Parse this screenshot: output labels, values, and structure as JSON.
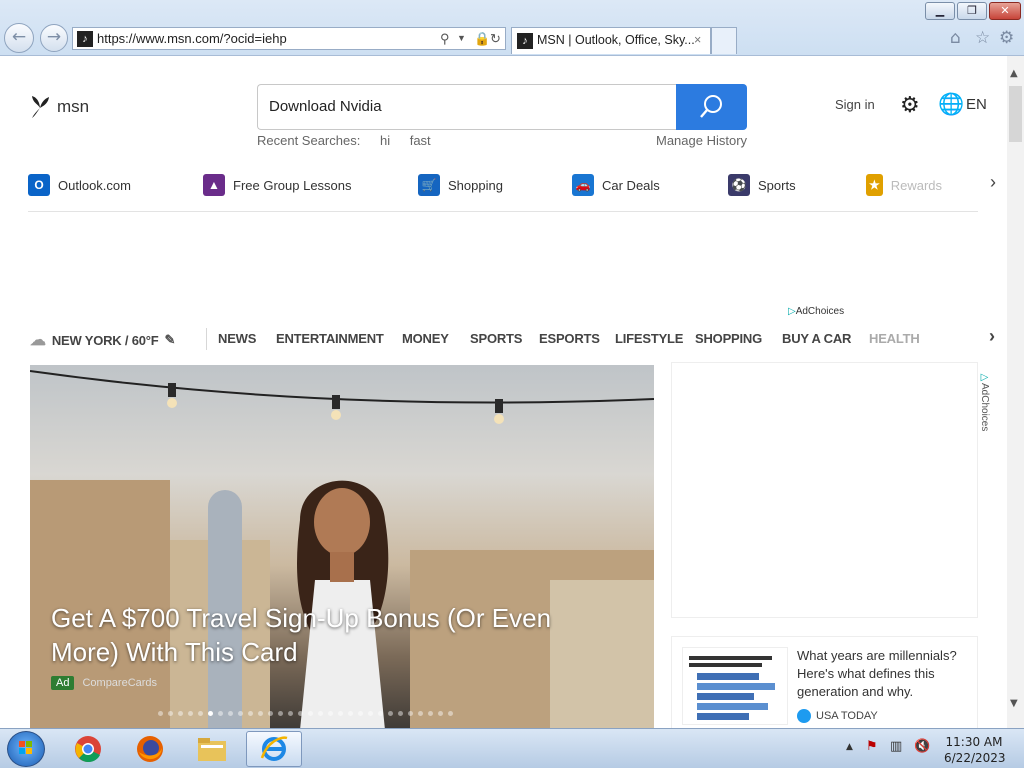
{
  "browser": {
    "address": "https://www.msn.com/?ocid=iehp",
    "tab_title": "MSN | Outlook, Office, Sky...",
    "tab_close": "×",
    "window": {
      "minimize": "▁",
      "maximize": "❐",
      "close": "✕"
    }
  },
  "msn": {
    "logo_text": "msn",
    "search_value": "Download Nvidia",
    "recent_label": "Recent Searches:",
    "recent_items": [
      "hi",
      "fast"
    ],
    "manage_history": "Manage History",
    "sign_in": "Sign in",
    "lang": "EN"
  },
  "quick_links": [
    {
      "label": "Outlook.com",
      "icon": "outlook-icon",
      "color": "#0a64c8"
    },
    {
      "label": "Free Group Lessons",
      "icon": "graduation-cap-icon",
      "color": "#6a2c8a"
    },
    {
      "label": "Shopping",
      "icon": "shopping-cart-icon",
      "color": "#1565c0"
    },
    {
      "label": "Car Deals",
      "icon": "car-icon",
      "color": "#1976d2"
    },
    {
      "label": "Sports",
      "icon": "sports-ball-icon",
      "color": "#3a3a6a"
    },
    {
      "label": "Rewards",
      "icon": "medal-icon",
      "color": "#e0a000"
    }
  ],
  "ad_choices": "AdChoices",
  "categories": {
    "weather": "NEW YORK / 60°F",
    "items": [
      "NEWS",
      "ENTERTAINMENT",
      "MONEY",
      "SPORTS",
      "ESPORTS",
      "LIFESTYLE",
      "SHOPPING",
      "BUY A CAR",
      "HEALTH"
    ]
  },
  "hero": {
    "title": "Get A $700 Travel Sign-Up Bonus (Or Even More) With This Card",
    "ad_badge": "Ad",
    "source": "CompareCards",
    "dot_count": 30,
    "active_dot": 5
  },
  "side_card": {
    "headline": "What years are millennials? Here's what defines this generation and why.",
    "source": "USA TODAY"
  },
  "taskbar": {
    "time": "11:30 AM",
    "date": "6/22/2023"
  }
}
